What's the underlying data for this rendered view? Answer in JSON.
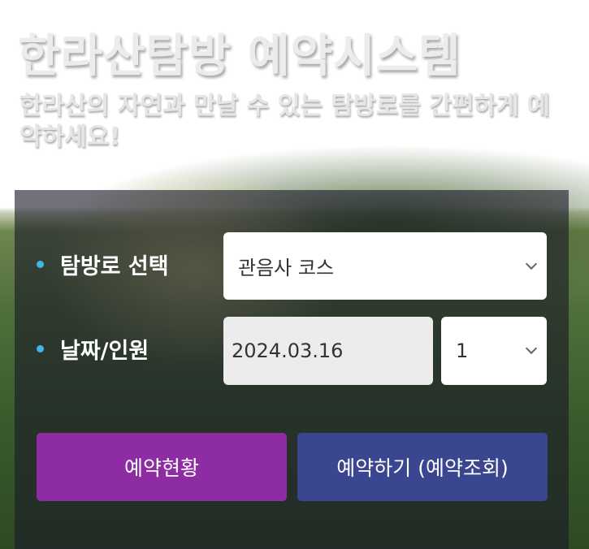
{
  "hero": {
    "title": "한라산탐방 예약시스템",
    "subtitle": "한라산의 자연과 만날 수 있는 탐방로를 간편하게 예약하세요!"
  },
  "form": {
    "trail_label": "탐방로 선택",
    "trail_value": "관음사 코스",
    "date_label": "날짜/인원",
    "date_value": "2024.03.16",
    "people_value": "1"
  },
  "buttons": {
    "status_label": "예약현황",
    "reserve_label": "예약하기 (예약조회)"
  },
  "colors": {
    "accent_dot": "#3fb5e8",
    "status_button": "#8e2ca3",
    "reserve_button": "#3a468f"
  },
  "icons": {
    "bullet": "bullet-dot-icon",
    "dropdown": "chevron-down-icon"
  }
}
